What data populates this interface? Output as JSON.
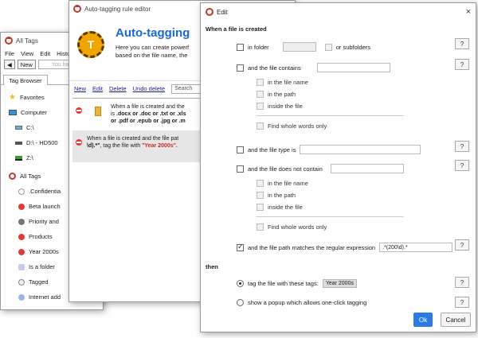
{
  "main_window": {
    "title": "All Tags",
    "menu": [
      "File",
      "View",
      "Edit",
      "Histo"
    ],
    "new_button": "New",
    "search_placeholder": "You ha",
    "tab": "Tag Browser",
    "tree": [
      {
        "label": "Favorites",
        "icon": "star-icon"
      },
      {
        "label": "Computer",
        "icon": "computer-icon"
      },
      {
        "label": "C:\\",
        "icon": "drive-icon"
      },
      {
        "label": "D:\\ - HD500",
        "icon": "drive-icon"
      },
      {
        "label": "Z:\\",
        "icon": "network-drive-icon"
      },
      {
        "label": "All Tags",
        "icon": "tag-logo-icon"
      },
      {
        "label": ".Confidentia",
        "icon": "tag-icon"
      },
      {
        "label": "Beta launch",
        "icon": "tag-icon"
      },
      {
        "label": "Priority and",
        "icon": "tag-icon"
      },
      {
        "label": "Products",
        "icon": "tag-icon"
      },
      {
        "label": "Year 2000s",
        "icon": "tag-icon"
      },
      {
        "label": "Is a folder",
        "icon": "tag-icon"
      },
      {
        "label": "Tagged",
        "icon": "tag-icon"
      },
      {
        "label": "Internet add",
        "icon": "tag-icon"
      }
    ]
  },
  "rule_editor": {
    "title": "Auto-tagging rule editor",
    "heading": "Auto-tagging",
    "desc_line1": "Here you can create powerf",
    "desc_line2": "based on the file name, the",
    "links": [
      "New",
      "Edit",
      "Delete",
      "Undo delete"
    ],
    "search_value": "Search",
    "rules": [
      {
        "line1": "When a file is created  and the",
        "line2_pre": "is ",
        "line2_bold": ".docx or .doc or .txt or .xls",
        "line3_bold": "or .pdf or .epub or .jpg or .m"
      },
      {
        "line1": "When a file is created  and the file pat",
        "line2_bold": "\\d).*\"",
        "line2_mid": ", tag the file with ",
        "line2_tag": "\"Year 2000s\"."
      }
    ]
  },
  "edit_dialog": {
    "title": "Edit",
    "close": "×",
    "section_when": "When a file is created",
    "in_folder": "in folder",
    "or_subfolders": "or subfolders",
    "file_contains": "and the file contains",
    "in_file_name": "in the file name",
    "in_path": "in the path",
    "inside_file": "inside the file",
    "whole_words": "Find whole words only",
    "file_type": "and the file type is",
    "not_contain": "and the file does not contain",
    "in_file_name2": "in the file name",
    "in_path2": "in the path",
    "inside_file2": "inside the file",
    "whole_words2": "Find whole words only",
    "path_regex": "and the file path matches the regular expression",
    "regex_value": ".*(200\\d).*",
    "section_then": "then",
    "tag_with": "tag the file with these tags:",
    "tag_value": "Year 2000s",
    "popup": "show a popup which allows one-click tagging",
    "help": "?",
    "ok": "Ok",
    "cancel": "Cancel"
  }
}
